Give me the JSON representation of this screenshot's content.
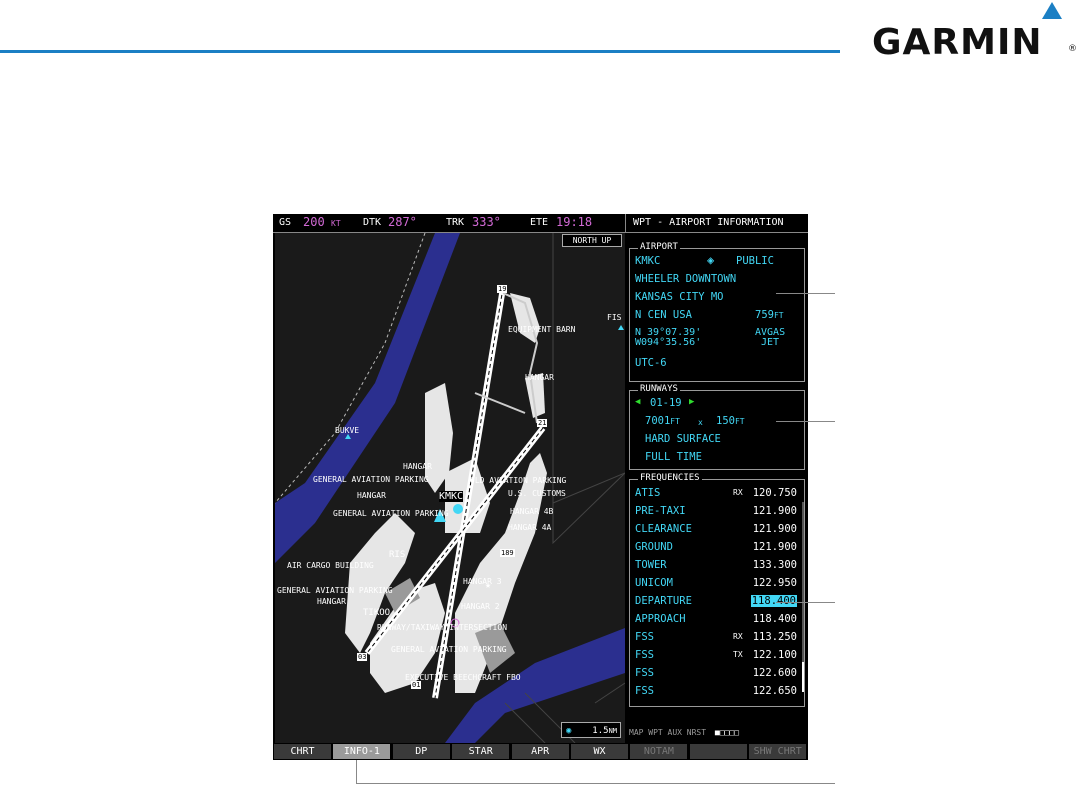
{
  "brand": {
    "name": "GARMIN",
    "reg": "®"
  },
  "header": {
    "gs_label": "GS",
    "gs_value": "200",
    "gs_unit": "KT",
    "dtk_label": "DTK",
    "dtk_value": "287°",
    "trk_label": "TRK",
    "trk_value": "333°",
    "ete_label": "ETE",
    "ete_value": "19:18",
    "page_title": "WPT - AIRPORT INFORMATION"
  },
  "map": {
    "north_up": "NORTH UP",
    "scale": "1.5",
    "scale_unit": "NM",
    "labels": {
      "equipment_barn": "EQUIPMENT BARN",
      "fis": "FIS",
      "hangar_top": "HANGAR",
      "bukve": "BUKVE",
      "hangar_mid": "HANGAR",
      "ga_parking_1": "GENERAL AVIATION PARKING",
      "old_aviation_parking": "OLD AVIATION PARKING",
      "hangar_left": "HANGAR",
      "kmkc": "KMKC",
      "us_customs": "U.S. CUSTOMS",
      "ga_parking_2": "GENERAL AVIATION PARKING",
      "hangar_4b": "HANGAR 4B",
      "hangar_4a": "HANGAR 4A",
      "ris": "RIS",
      "air_cargo": "AIR CARGO BUILDING",
      "hangar_3": "HANGAR 3",
      "ga_parking_3": "GENERAL AVIATION PARKING",
      "hangar_low": "HANGAR",
      "tikoo": "TIKOO",
      "hangar_2": "HANGAR 2",
      "rwy_intersection": "RUNWAY/TAXIWAY INTERSECTION",
      "ga_parking_4": "GENERAL AVIATION PARKING",
      "beechcraft": "EXECUTIVE BEECHCRAFT FBO",
      "rwy_19": "19",
      "rwy_21": "21",
      "rwy_03": "03",
      "rwy_01": "01",
      "marker_189": "189"
    }
  },
  "airport": {
    "title": "AIRPORT",
    "ident": "KMKC",
    "type": "PUBLIC",
    "name": "WHEELER DOWNTOWN",
    "city": "KANSAS CITY MO",
    "region": "N CEN USA",
    "elevation": "759",
    "elevation_unit": "FT",
    "lat": "N 39°07.39'",
    "lon": "W094°35.56'",
    "fuel1": "AVGAS",
    "fuel2": "JET",
    "utc": "UTC-6"
  },
  "runways": {
    "title": "RUNWAYS",
    "id": "01-19",
    "length": "7001",
    "length_unit": "FT",
    "x": "x",
    "width": "150",
    "width_unit": "FT",
    "surface": "HARD SURFACE",
    "hours": "FULL TIME"
  },
  "frequencies": {
    "title": "FREQUENCIES",
    "rows": [
      {
        "name": "ATIS",
        "rt": "RX",
        "freq": "120.750"
      },
      {
        "name": "PRE-TAXI",
        "rt": "",
        "freq": "121.900"
      },
      {
        "name": "CLEARANCE",
        "rt": "",
        "freq": "121.900"
      },
      {
        "name": "GROUND",
        "rt": "",
        "freq": "121.900"
      },
      {
        "name": "TOWER",
        "rt": "",
        "freq": "133.300"
      },
      {
        "name": "UNICOM",
        "rt": "",
        "freq": "122.950"
      },
      {
        "name": "DEPARTURE",
        "rt": "",
        "freq": "118.400",
        "selected": true
      },
      {
        "name": "APPROACH",
        "rt": "",
        "freq": "118.400"
      },
      {
        "name": "FSS",
        "rt": "RX",
        "freq": "113.250"
      },
      {
        "name": "FSS",
        "rt": "TX",
        "freq": "122.100"
      },
      {
        "name": "FSS",
        "rt": "",
        "freq": "122.600"
      },
      {
        "name": "FSS",
        "rt": "",
        "freq": "122.650"
      }
    ]
  },
  "status_bar": "MAP WPT AUX NRST",
  "softkeys": [
    "CHRT",
    "INFO-1",
    "DP",
    "STAR",
    "APR",
    "WX",
    "NOTAM",
    "",
    "SHW CHRT"
  ],
  "colors": {
    "cyan": "#42d7f5",
    "magenta": "#d36ad6",
    "green": "#2fdd2f",
    "accent": "#1b7fc4",
    "water": "#2b2f8f"
  }
}
